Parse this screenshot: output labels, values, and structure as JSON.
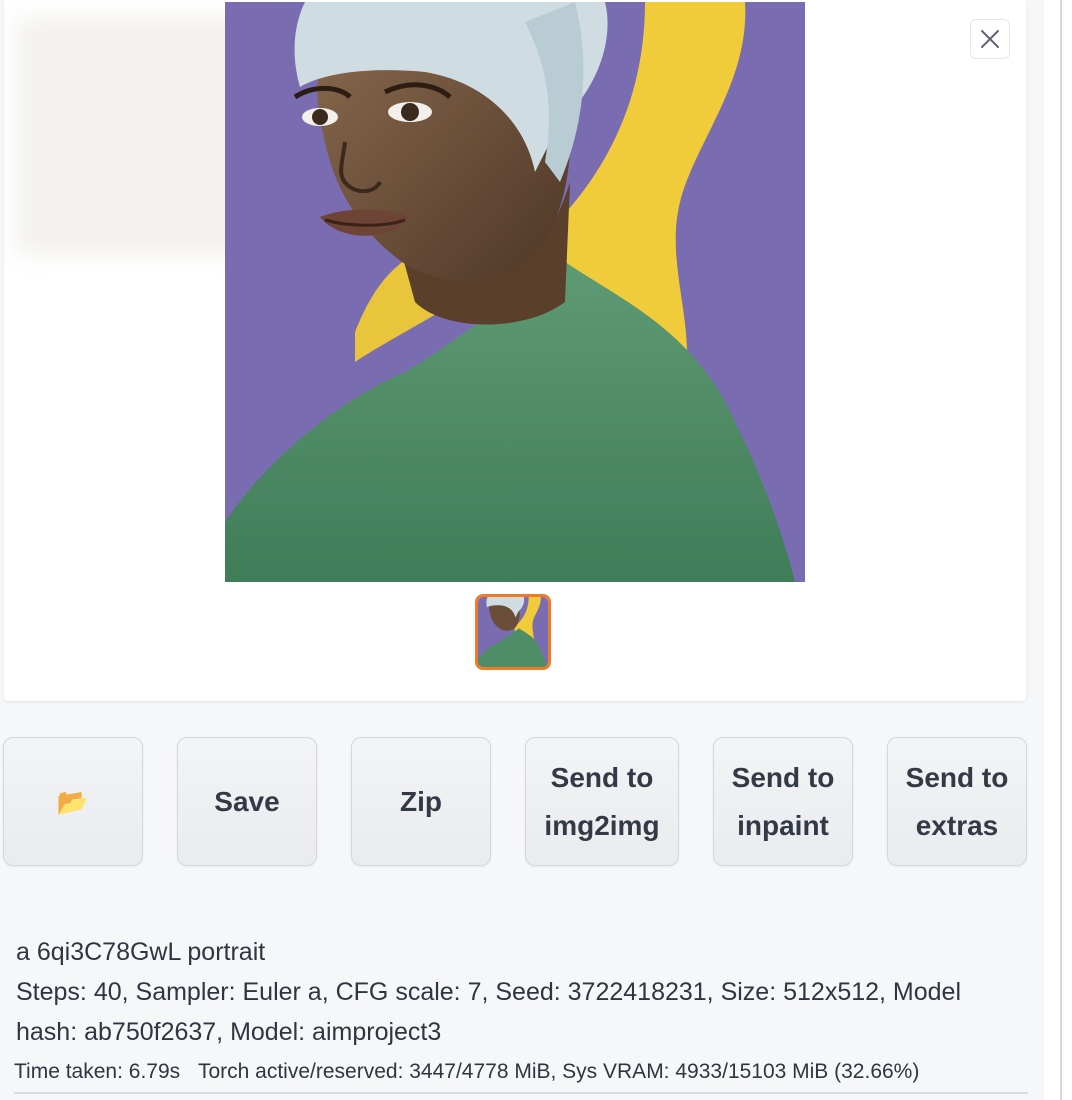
{
  "gallery": {
    "close_label": "Close",
    "main_image_alt": "",
    "thumbnail_count": 1
  },
  "actions": {
    "folder_icon": "📂",
    "save_label": "Save",
    "zip_label": "Zip",
    "send_img2img_line1": "Send to",
    "send_img2img_line2": "img2img",
    "send_inpaint_line1": "Send to",
    "send_inpaint_line2": "inpaint",
    "send_extras_line1": "Send to",
    "send_extras_line2": "extras"
  },
  "generation_info": {
    "prompt": "a 6qi3C78GwL portrait",
    "params_line1": "Steps: 40, Sampler: Euler a, CFG scale: 7, Seed: 3722418231, Size: 512x512, Model",
    "params_line2": "hash: ab750f2637, Model: aimproject3",
    "time_taken": "Time taken: 6.79s",
    "memory": "Torch active/reserved: 3447/4778 MiB, Sys VRAM: 4933/15103 MiB (32.66%)"
  },
  "colors": {
    "accent_orange": "#f07b26",
    "background": "#f6f7f9",
    "panel": "#ffffff"
  }
}
